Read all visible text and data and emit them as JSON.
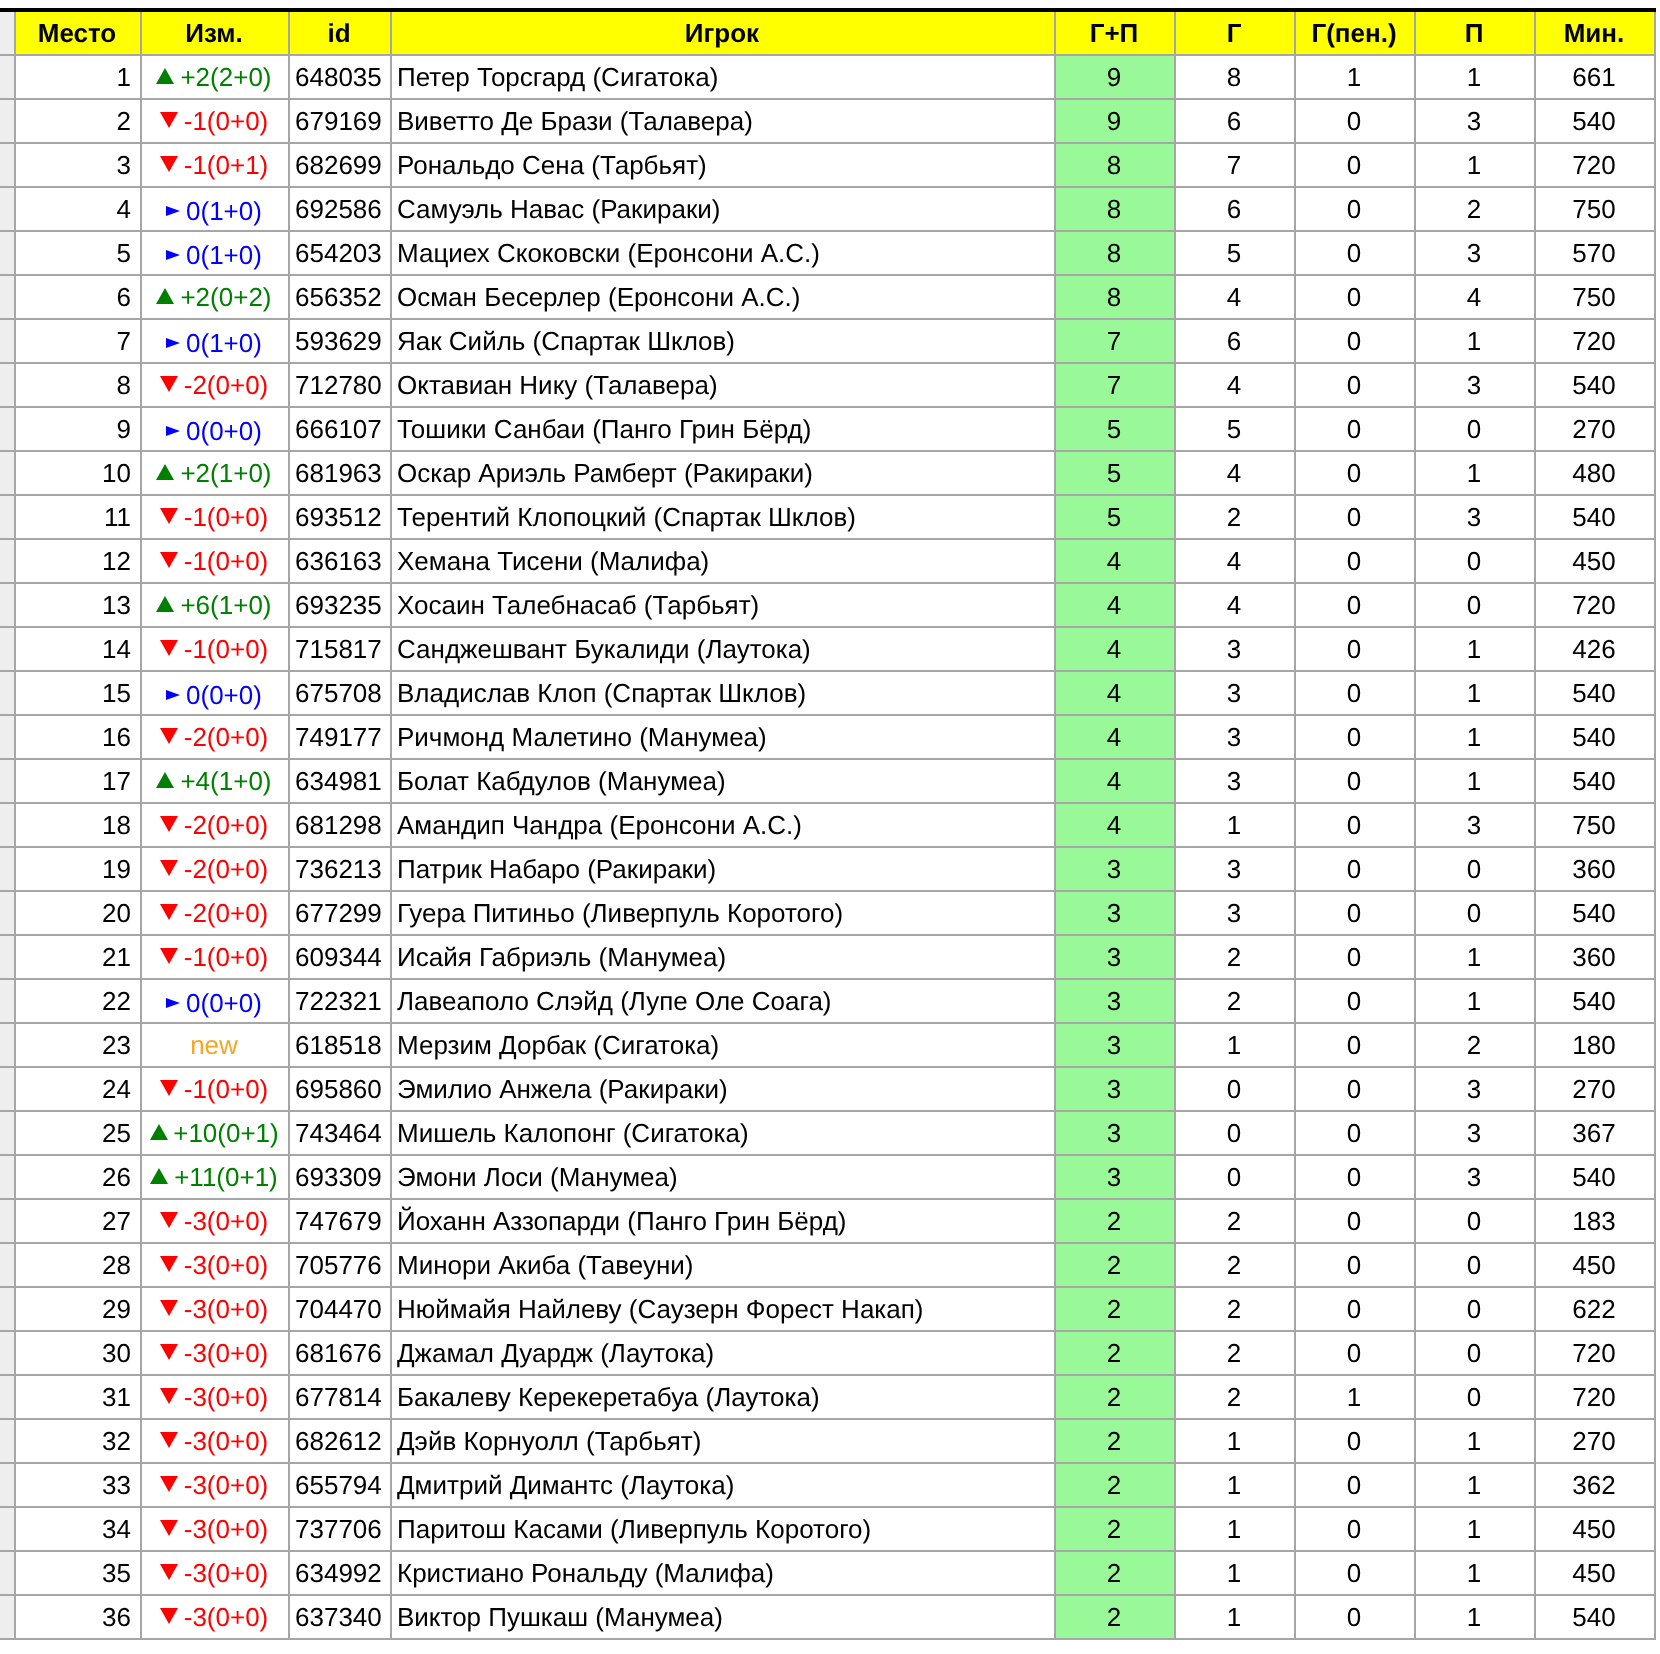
{
  "columns": [
    "Место",
    "Изм.",
    "id",
    "Игрок",
    "Г+П",
    "Г",
    "Г(пен.)",
    "П",
    "Мин."
  ],
  "rows": [
    {
      "place": "1",
      "kind": "up",
      "change": "+2(2+0)",
      "id": "648035",
      "player": "Петер Торсгард (Сигатока)",
      "gp": "9",
      "g": "8",
      "gpen": "1",
      "p": "1",
      "min": "661"
    },
    {
      "place": "2",
      "kind": "down",
      "change": "-1(0+0)",
      "id": "679169",
      "player": "Виветто Де Брази (Талавера)",
      "gp": "9",
      "g": "6",
      "gpen": "0",
      "p": "3",
      "min": "540"
    },
    {
      "place": "3",
      "kind": "down",
      "change": "-1(0+1)",
      "id": "682699",
      "player": "Рональдо Сена (Тарбьят)",
      "gp": "8",
      "g": "7",
      "gpen": "0",
      "p": "1",
      "min": "720"
    },
    {
      "place": "4",
      "kind": "same",
      "change": "0(1+0)",
      "id": "692586",
      "player": "Самуэль Навас (Ракираки)",
      "gp": "8",
      "g": "6",
      "gpen": "0",
      "p": "2",
      "min": "750"
    },
    {
      "place": "5",
      "kind": "same",
      "change": "0(1+0)",
      "id": "654203",
      "player": "Мациех Скоковски (Еронсони А.С.)",
      "gp": "8",
      "g": "5",
      "gpen": "0",
      "p": "3",
      "min": "570"
    },
    {
      "place": "6",
      "kind": "up",
      "change": "+2(0+2)",
      "id": "656352",
      "player": "Осман Бесерлер (Еронсони А.С.)",
      "gp": "8",
      "g": "4",
      "gpen": "0",
      "p": "4",
      "min": "750"
    },
    {
      "place": "7",
      "kind": "same",
      "change": "0(1+0)",
      "id": "593629",
      "player": "Яак Сийль (Спартак Шклов)",
      "gp": "7",
      "g": "6",
      "gpen": "0",
      "p": "1",
      "min": "720"
    },
    {
      "place": "8",
      "kind": "down",
      "change": "-2(0+0)",
      "id": "712780",
      "player": "Октавиан Нику (Талавера)",
      "gp": "7",
      "g": "4",
      "gpen": "0",
      "p": "3",
      "min": "540"
    },
    {
      "place": "9",
      "kind": "same",
      "change": "0(0+0)",
      "id": "666107",
      "player": "Тошики Санбаи (Панго Грин Бёрд)",
      "gp": "5",
      "g": "5",
      "gpen": "0",
      "p": "0",
      "min": "270"
    },
    {
      "place": "10",
      "kind": "up",
      "change": "+2(1+0)",
      "id": "681963",
      "player": "Оскар Ариэль Рамберт (Ракираки)",
      "gp": "5",
      "g": "4",
      "gpen": "0",
      "p": "1",
      "min": "480"
    },
    {
      "place": "11",
      "kind": "down",
      "change": "-1(0+0)",
      "id": "693512",
      "player": "Терентий Клопоцкий (Спартак Шклов)",
      "gp": "5",
      "g": "2",
      "gpen": "0",
      "p": "3",
      "min": "540"
    },
    {
      "place": "12",
      "kind": "down",
      "change": "-1(0+0)",
      "id": "636163",
      "player": "Хемана Тисени (Малифа)",
      "gp": "4",
      "g": "4",
      "gpen": "0",
      "p": "0",
      "min": "450"
    },
    {
      "place": "13",
      "kind": "up",
      "change": "+6(1+0)",
      "id": "693235",
      "player": "Хосаин Талебнасаб (Тарбьят)",
      "gp": "4",
      "g": "4",
      "gpen": "0",
      "p": "0",
      "min": "720"
    },
    {
      "place": "14",
      "kind": "down",
      "change": "-1(0+0)",
      "id": "715817",
      "player": "Санджешвант Букалиди (Лаутока)",
      "gp": "4",
      "g": "3",
      "gpen": "0",
      "p": "1",
      "min": "426"
    },
    {
      "place": "15",
      "kind": "same",
      "change": "0(0+0)",
      "id": "675708",
      "player": "Владислав Клоп (Спартак Шклов)",
      "gp": "4",
      "g": "3",
      "gpen": "0",
      "p": "1",
      "min": "540"
    },
    {
      "place": "16",
      "kind": "down",
      "change": "-2(0+0)",
      "id": "749177",
      "player": "Ричмонд Малетино (Манумеа)",
      "gp": "4",
      "g": "3",
      "gpen": "0",
      "p": "1",
      "min": "540"
    },
    {
      "place": "17",
      "kind": "up",
      "change": "+4(1+0)",
      "id": "634981",
      "player": "Болат Кабдулов (Манумеа)",
      "gp": "4",
      "g": "3",
      "gpen": "0",
      "p": "1",
      "min": "540"
    },
    {
      "place": "18",
      "kind": "down",
      "change": "-2(0+0)",
      "id": "681298",
      "player": "Амандип Чандра (Еронсони А.С.)",
      "gp": "4",
      "g": "1",
      "gpen": "0",
      "p": "3",
      "min": "750"
    },
    {
      "place": "19",
      "kind": "down",
      "change": "-2(0+0)",
      "id": "736213",
      "player": "Патрик Набаро (Ракираки)",
      "gp": "3",
      "g": "3",
      "gpen": "0",
      "p": "0",
      "min": "360"
    },
    {
      "place": "20",
      "kind": "down",
      "change": "-2(0+0)",
      "id": "677299",
      "player": "Гуера Питиньо (Ливерпуль Коротого)",
      "gp": "3",
      "g": "3",
      "gpen": "0",
      "p": "0",
      "min": "540"
    },
    {
      "place": "21",
      "kind": "down",
      "change": "-1(0+0)",
      "id": "609344",
      "player": "Исайя Габриэль (Манумеа)",
      "gp": "3",
      "g": "2",
      "gpen": "0",
      "p": "1",
      "min": "360"
    },
    {
      "place": "22",
      "kind": "same",
      "change": "0(0+0)",
      "id": "722321",
      "player": "Лавеаполо Слэйд (Лупе Оле Соага)",
      "gp": "3",
      "g": "2",
      "gpen": "0",
      "p": "1",
      "min": "540"
    },
    {
      "place": "23",
      "kind": "new",
      "change": "new",
      "id": "618518",
      "player": "Мерзим Дорбак (Сигатока)",
      "gp": "3",
      "g": "1",
      "gpen": "0",
      "p": "2",
      "min": "180"
    },
    {
      "place": "24",
      "kind": "down",
      "change": "-1(0+0)",
      "id": "695860",
      "player": "Эмилио Анжела (Ракираки)",
      "gp": "3",
      "g": "0",
      "gpen": "0",
      "p": "3",
      "min": "270"
    },
    {
      "place": "25",
      "kind": "up",
      "change": "+10(0+1)",
      "id": "743464",
      "player": "Мишель Калопонг (Сигатока)",
      "gp": "3",
      "g": "0",
      "gpen": "0",
      "p": "3",
      "min": "367"
    },
    {
      "place": "26",
      "kind": "up",
      "change": "+11(0+1)",
      "id": "693309",
      "player": "Эмони Лоси (Манумеа)",
      "gp": "3",
      "g": "0",
      "gpen": "0",
      "p": "3",
      "min": "540"
    },
    {
      "place": "27",
      "kind": "down",
      "change": "-3(0+0)",
      "id": "747679",
      "player": "Йоханн Аззопарди (Панго Грин Бёрд)",
      "gp": "2",
      "g": "2",
      "gpen": "0",
      "p": "0",
      "min": "183"
    },
    {
      "place": "28",
      "kind": "down",
      "change": "-3(0+0)",
      "id": "705776",
      "player": "Минори Акиба (Тавеуни)",
      "gp": "2",
      "g": "2",
      "gpen": "0",
      "p": "0",
      "min": "450"
    },
    {
      "place": "29",
      "kind": "down",
      "change": "-3(0+0)",
      "id": "704470",
      "player": "Нюймайя Найлеву (Саузерн Форест Накап)",
      "gp": "2",
      "g": "2",
      "gpen": "0",
      "p": "0",
      "min": "622"
    },
    {
      "place": "30",
      "kind": "down",
      "change": "-3(0+0)",
      "id": "681676",
      "player": "Джамал Дуардж (Лаутока)",
      "gp": "2",
      "g": "2",
      "gpen": "0",
      "p": "0",
      "min": "720"
    },
    {
      "place": "31",
      "kind": "down",
      "change": "-3(0+0)",
      "id": "677814",
      "player": "Бакалеву Керекеретабуа (Лаутока)",
      "gp": "2",
      "g": "2",
      "gpen": "1",
      "p": "0",
      "min": "720"
    },
    {
      "place": "32",
      "kind": "down",
      "change": "-3(0+0)",
      "id": "682612",
      "player": "Дэйв Корнуолл (Тарбьят)",
      "gp": "2",
      "g": "1",
      "gpen": "0",
      "p": "1",
      "min": "270"
    },
    {
      "place": "33",
      "kind": "down",
      "change": "-3(0+0)",
      "id": "655794",
      "player": "Дмитрий Димантс (Лаутока)",
      "gp": "2",
      "g": "1",
      "gpen": "0",
      "p": "1",
      "min": "362"
    },
    {
      "place": "34",
      "kind": "down",
      "change": "-3(0+0)",
      "id": "737706",
      "player": "Паритош Касами (Ливерпуль Коротого)",
      "gp": "2",
      "g": "1",
      "gpen": "0",
      "p": "1",
      "min": "450"
    },
    {
      "place": "35",
      "kind": "down",
      "change": "-3(0+0)",
      "id": "634992",
      "player": "Кристиано Рональду (Малифа)",
      "gp": "2",
      "g": "1",
      "gpen": "0",
      "p": "1",
      "min": "450"
    },
    {
      "place": "36",
      "kind": "down",
      "change": "-3(0+0)",
      "id": "637340",
      "player": "Виктор Пушкаш (Манумеа)",
      "gp": "2",
      "g": "1",
      "gpen": "0",
      "p": "1",
      "min": "540"
    }
  ]
}
